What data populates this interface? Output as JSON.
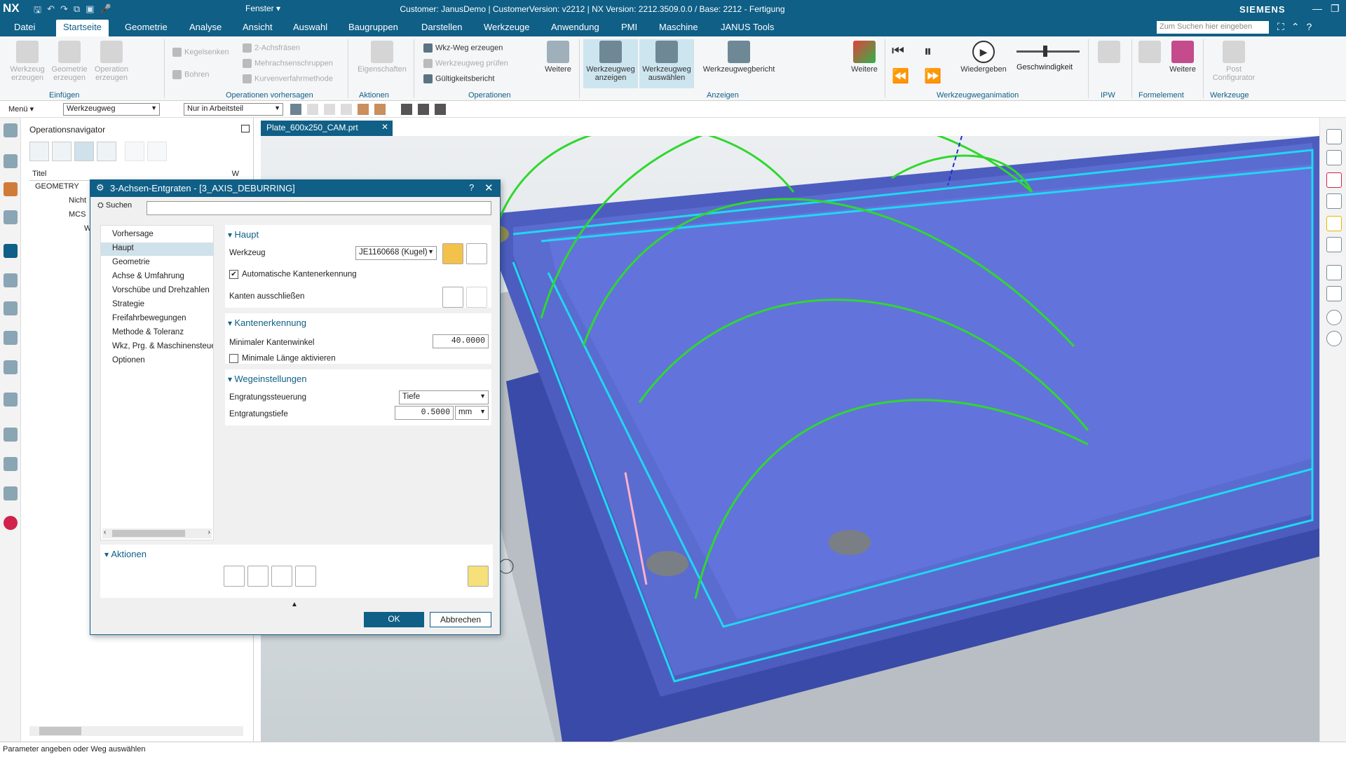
{
  "titlebar": {
    "logo": "NX",
    "fenster": "Fenster ▾",
    "title": "Customer: JanusDemo | CustomerVersion: v2212 | NX Version: 2212.3509.0.0 / Base: 2212 - Fertigung",
    "brand": "SIEMENS"
  },
  "menubar": {
    "tabs": [
      "Datei",
      "Startseite",
      "Geometrie",
      "Analyse",
      "Ansicht",
      "Auswahl",
      "Baugruppen",
      "Darstellen",
      "Werkzeuge",
      "Anwendung",
      "PMI",
      "Maschine",
      "JANUS Tools"
    ],
    "active_tab": "Startseite",
    "search_placeholder": "Zum Suchen hier eingeben"
  },
  "ribbon": {
    "einfuegen": {
      "b1": "Werkzeug\nerzeugen",
      "b2": "Geometrie\nerzeugen",
      "b3": "Operation\nerzeugen",
      "group": "Einfügen"
    },
    "vorhersagen": {
      "kegel": "Kegelsenken",
      "bohren": "Bohren",
      "achs": "2-Achsfräsen",
      "mehr": "Mehrachsenschruppen",
      "kurven": "Kurvenverfahrmethode",
      "group": "Operationen vorhersagen"
    },
    "aktionen": {
      "eigen": "Eigenschaften",
      "group": "Aktionen"
    },
    "operationen": {
      "wkz": "Wkz-Weg erzeugen",
      "pruef": "Werkzeugweg prüfen",
      "guelt": "Gültigkeitsbericht",
      "weitere": "Weitere",
      "group": "Operationen"
    },
    "anzeigen": {
      "anz": "Werkzeugweg\nanzeigen",
      "aus": "Werkzeugweg\nauswählen",
      "ber": "Werkzeugwegbericht",
      "weitere": "Weitere",
      "group": "Anzeigen"
    },
    "animation": {
      "wieder": "Wiedergeben",
      "speed": "Geschwindigkeit",
      "group": "Werkzeugweganimation"
    },
    "ipw": {
      "group": "IPW"
    },
    "formel": {
      "weitere": "Weitere",
      "group": "Formelement"
    },
    "werkzeuge": {
      "post": "Post\nConfigurator",
      "group": "Werkzeuge"
    }
  },
  "toolbar2": {
    "menu": "Menü ▾",
    "filter": "Werkzeugweg",
    "scope": "Nur in Arbeitsteil"
  },
  "navigator": {
    "title": "Operationsnavigator",
    "col_title": "Titel",
    "col_w": "W",
    "tree": [
      "GEOMETRY",
      "Nicht",
      "MCS",
      "W"
    ]
  },
  "viewtab": {
    "label": "Plate_600x250_CAM.prt"
  },
  "dialog": {
    "title": "3-Achsen-Entgraten - [3_AXIS_DEBURRING]",
    "help": "?",
    "search_label": "Suchen",
    "list": [
      "Vorhersage",
      "Haupt",
      "Geometrie",
      "Achse & Umfahrung",
      "Vorschübe und Drehzahlen",
      "Strategie",
      "Freifahrbewegungen",
      "Methode & Toleranz",
      "Wkz, Prg. & Maschinensteuerung",
      "Optionen"
    ],
    "selected": "Haupt",
    "haupt": {
      "header": "Haupt",
      "werkzeug_label": "Werkzeug",
      "werkzeug_value": "JE1160668 (Kugel)",
      "auto_label": "Automatische Kantenerkennung",
      "auto_checked": true,
      "kanten_label": "Kanten ausschließen"
    },
    "kantenerkennung": {
      "header": "Kantenerkennung",
      "minwinkel_label": "Minimaler Kantenwinkel",
      "minwinkel_value": "40.0000",
      "minlaenge_label": "Minimale Länge aktivieren",
      "minlaenge_checked": false
    },
    "weg": {
      "header": "Wegeinstellungen",
      "steuer_label": "Engratungssteuerung",
      "steuer_value": "Tiefe",
      "tiefe_label": "Entgratungstiefe",
      "tiefe_value": "0.5000",
      "tiefe_unit": "mm"
    },
    "aktionen_header": "Aktionen",
    "ok": "OK",
    "cancel": "Abbrechen"
  },
  "statusbar": {
    "text": "Parameter angeben oder Weg auswählen"
  },
  "triad": {
    "x": "X"
  },
  "colors": {
    "accent": "#0f5f86",
    "part": "#3b4fb5",
    "toolpath": "#2fd82f",
    "rim": "#20d8f0"
  }
}
